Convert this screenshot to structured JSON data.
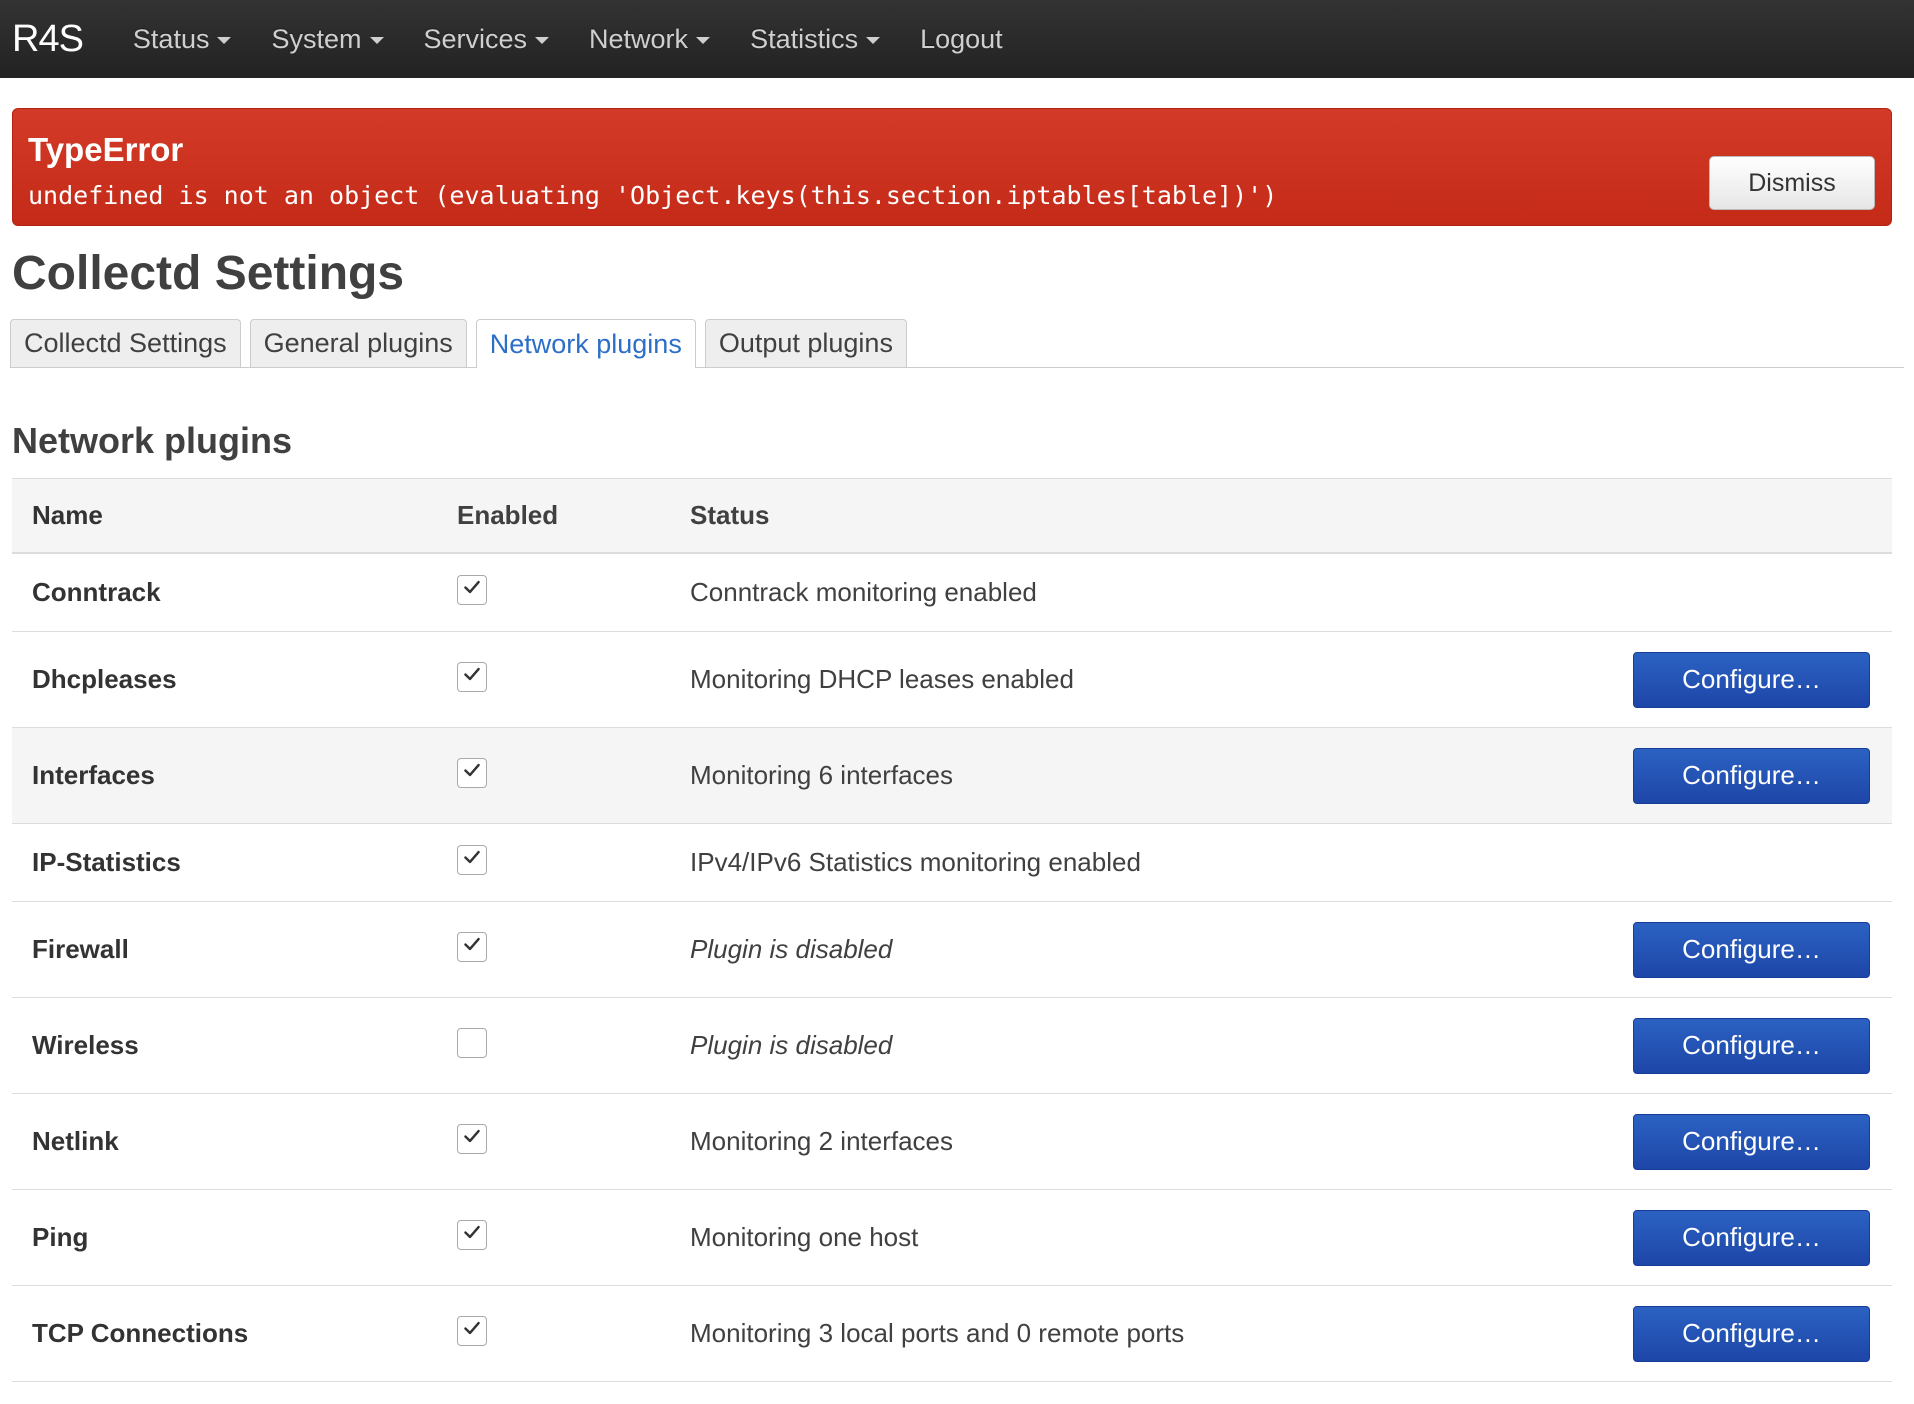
{
  "nav": {
    "brand": "R4S",
    "items": [
      {
        "label": "Status",
        "dropdown": true
      },
      {
        "label": "System",
        "dropdown": true
      },
      {
        "label": "Services",
        "dropdown": true
      },
      {
        "label": "Network",
        "dropdown": true
      },
      {
        "label": "Statistics",
        "dropdown": true
      },
      {
        "label": "Logout",
        "dropdown": false
      }
    ]
  },
  "alert": {
    "title": "TypeError",
    "message": "undefined is not an object (evaluating 'Object.keys(this.section.iptables[table])')",
    "dismiss_label": "Dismiss",
    "color": "#c8321e"
  },
  "page": {
    "title": "Collectd Settings"
  },
  "tabs": [
    {
      "label": "Collectd Settings",
      "active": false
    },
    {
      "label": "General plugins",
      "active": false
    },
    {
      "label": "Network plugins",
      "active": true
    },
    {
      "label": "Output plugins",
      "active": false
    }
  ],
  "section": {
    "title": "Network plugins",
    "columns": {
      "name": "Name",
      "enabled": "Enabled",
      "status": "Status"
    },
    "configure_label": "Configure…",
    "rows": [
      {
        "name": "Conntrack",
        "enabled": true,
        "status": "Conntrack monitoring enabled",
        "italic": false,
        "configurable": false
      },
      {
        "name": "Dhcpleases",
        "enabled": true,
        "status": "Monitoring DHCP leases enabled",
        "italic": false,
        "configurable": true
      },
      {
        "name": "Interfaces",
        "enabled": true,
        "status": "Monitoring 6 interfaces",
        "italic": false,
        "configurable": true
      },
      {
        "name": "IP-Statistics",
        "enabled": true,
        "status": "IPv4/IPv6 Statistics monitoring enabled",
        "italic": false,
        "configurable": false
      },
      {
        "name": "Firewall",
        "enabled": true,
        "status": "Plugin is disabled",
        "italic": true,
        "configurable": true
      },
      {
        "name": "Wireless",
        "enabled": false,
        "status": "Plugin is disabled",
        "italic": true,
        "configurable": true
      },
      {
        "name": "Netlink",
        "enabled": true,
        "status": "Monitoring 2 interfaces",
        "italic": false,
        "configurable": true
      },
      {
        "name": "Ping",
        "enabled": true,
        "status": "Monitoring one host",
        "italic": false,
        "configurable": true
      },
      {
        "name": "TCP Connections",
        "enabled": true,
        "status": "Monitoring 3 local ports and 0 remote ports",
        "italic": false,
        "configurable": true
      }
    ]
  }
}
